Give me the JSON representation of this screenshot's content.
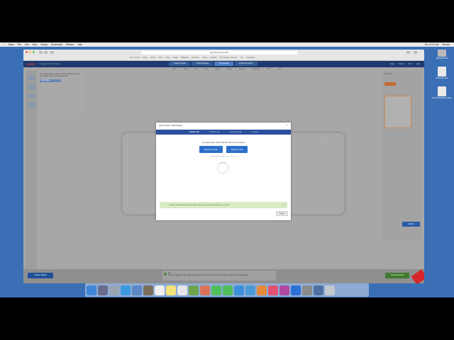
{
  "menubar": {
    "items": [
      "",
      "Safari",
      "File",
      "Edit",
      "View",
      "History",
      "Bookmarks",
      "Window",
      "Help"
    ],
    "status": [
      "Thu 10:21 AM",
      "Service"
    ]
  },
  "browser": {
    "url": "app.print.avery.com",
    "bookmarks": [
      "Home Useful",
      "Apple",
      "iCloud",
      "Yahoo",
      "Bing",
      "Google",
      "Wikipedia",
      "Facebook",
      "Twitter",
      "LinkedIn",
      "The Weather Channel",
      "Yelp",
      "TripAdvisor"
    ]
  },
  "avery": {
    "logo": "AVERY",
    "crumb": "/ Design & Print Online",
    "steps": [
      "1 Select Project",
      "2 Select Design",
      "3 Customize",
      "4 Preview & Print"
    ],
    "header_right": [
      "Save",
      "Share",
      "Print",
      "Help"
    ],
    "subtools": [
      "Undo",
      "Redo",
      "Cut",
      "Copy",
      "Paste",
      "Delete",
      "Arrange",
      "Alignment",
      "Zoom",
      "Grid"
    ],
    "left_panel_text": "Use Import Data to place names & addresses onto your design from a spreadsheet file.",
    "left_panel_button": "Import Data",
    "right_panel_title": "Navigator",
    "change_design": "Change Design",
    "tip_title": "Tip:",
    "tip_text": "Click your project in the middle of the screen. Use the tools on the left to edit or change the text and images.",
    "next_button": "Preview & Print",
    "edit_all_button": "Edit All"
  },
  "modal": {
    "title": "Import Data / Mail Merge",
    "close": "×",
    "steps": [
      "1 Import File",
      "2 Confirm List",
      "3 Arrange Fields",
      "4 Finish"
    ],
    "instruction": "To import data, select the file from your computer",
    "btn_browse": "Browse for file",
    "btn_myavery": "MyAvery file",
    "note": "Acceptable file types: .xls, .xlsx, .csv",
    "info_text": "Did you know? Most programs allow you to save your spreadsheet as a .csv file.",
    "cancel": "Cancel"
  },
  "desktop": {
    "icons": [
      "Macintosh HD",
      "Addresses.xlsx",
      "Avery Templates Folder"
    ]
  },
  "colors": {
    "desktop": "#3a6fb6",
    "avery_header": "#1d3a6e",
    "primary_button": "#2c6fca",
    "info_green": "#d8ecc3"
  }
}
